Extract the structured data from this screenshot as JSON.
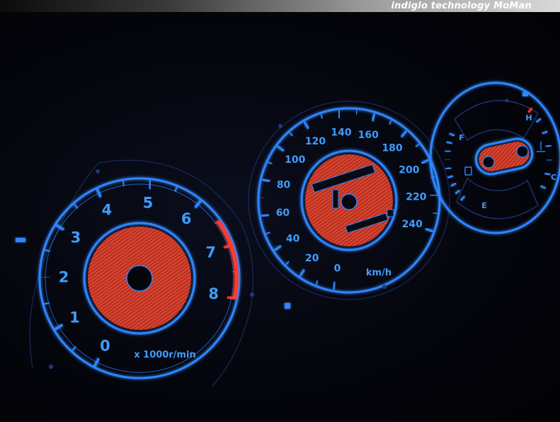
{
  "banner": {
    "text": "indiglo technology",
    "brand": "MoMan"
  },
  "tachometer": {
    "labels": [
      "0",
      "1",
      "2",
      "3",
      "4",
      "5",
      "6",
      "7",
      "8"
    ],
    "unit": "x 1000r/min",
    "redline_from": 6.5
  },
  "speedometer": {
    "labels": [
      "0",
      "20",
      "40",
      "60",
      "80",
      "100",
      "120",
      "140",
      "160",
      "180",
      "200",
      "220",
      "240"
    ],
    "unit": "km/h"
  },
  "combo_gauge": {
    "fuel": {
      "full": "F",
      "empty": "E"
    },
    "temp": {
      "hot": "H",
      "cold": "C"
    }
  },
  "colors": {
    "glow": "#2f86ff",
    "label": "#3f9cff",
    "redline": "#ff3a2a",
    "dial": "#e14733"
  }
}
